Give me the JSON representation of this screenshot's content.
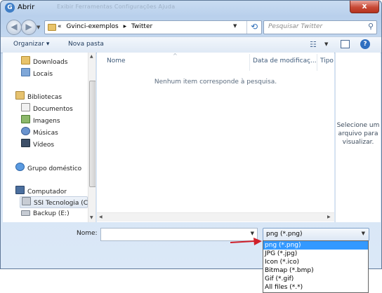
{
  "window": {
    "title": "Abrir",
    "ghost_menu": "Exibir    Ferramentas    Configurações    Ajuda",
    "close": "x"
  },
  "address": {
    "chevron": "«",
    "breadcrumb": [
      "Gvinci-exemplos",
      "Twitter"
    ],
    "separator": "▸",
    "refresh_glyph": "⟲"
  },
  "search": {
    "placeholder": "Pesquisar Twitter"
  },
  "toolbar": {
    "organize_label": "Organizar ▾",
    "new_folder_label": "Nova pasta",
    "view_glyph": "☷",
    "help_glyph": "?"
  },
  "nav": {
    "items": [
      {
        "label": "Downloads",
        "icon": "downloads-folder-icon"
      },
      {
        "label": "Locais",
        "icon": "places-icon"
      },
      {
        "label": "Bibliotecas",
        "icon": "libraries-icon"
      },
      {
        "label": "Documentos",
        "icon": "documents-icon"
      },
      {
        "label": "Imagens",
        "icon": "images-icon"
      },
      {
        "label": "Músicas",
        "icon": "music-icon"
      },
      {
        "label": "Vídeos",
        "icon": "videos-icon"
      },
      {
        "label": "Grupo doméstico",
        "icon": "homegroup-icon"
      },
      {
        "label": "Computador",
        "icon": "computer-icon"
      },
      {
        "label": "SSI Tecnologia (C",
        "icon": "drive-c-icon"
      },
      {
        "label": "Backup (E:)",
        "icon": "drive-e-icon"
      }
    ]
  },
  "list": {
    "columns": [
      "Nome",
      "Data de modificaç...",
      "Tipo"
    ],
    "empty_message": "Nenhum item corresponde à pesquisa."
  },
  "preview": {
    "message": "Selecione um arquivo para visualizar."
  },
  "bottom": {
    "name_label": "Nome:",
    "name_value": "",
    "type_selected": "png (*.png)",
    "type_options": [
      "png (*.png)",
      "JPG (*.jpg)",
      "Icon (*.ico)",
      "Bitmap (*.bmp)",
      "Gif (*.gif)",
      "All files (*.*)"
    ],
    "selected_option_index": 0
  },
  "colors": {
    "accent_selection": "#3399ff",
    "annotation_arrow": "#d0202a",
    "close_button": "#c84a36"
  }
}
